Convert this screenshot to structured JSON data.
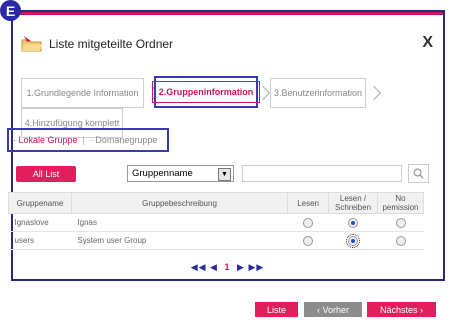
{
  "marker": "E",
  "dialog": {
    "title": "Liste mitgeteilte Ordner",
    "close_label": "X"
  },
  "steps": [
    {
      "label": "1.Grundlegende Information",
      "active": false
    },
    {
      "label": "2.Gruppeninformation",
      "active": true
    },
    {
      "label": "3.Benutzerinformation",
      "active": false
    },
    {
      "label": "4.Hinzufügung komplett",
      "active": false
    }
  ],
  "group_type": {
    "local": "Lokale Gruppe",
    "separator": "|",
    "domain": "Domanegruppe"
  },
  "toolbar": {
    "all_list_label": "All List",
    "filter_value": "Gruppenname",
    "search_value": ""
  },
  "table": {
    "headers": {
      "name": "Gruppename",
      "desc": "Gruppebeschreibung",
      "read": "Lesen",
      "rw_line1": "Lesen /",
      "rw_line2": "Schreiben",
      "np_line1": "No",
      "np_line2": "pemission"
    },
    "rows": [
      {
        "name": "Ignaslove",
        "desc": "Ignas",
        "selected": "rw"
      },
      {
        "name": "users",
        "desc": "System user Group",
        "selected": "rw"
      }
    ]
  },
  "pager": {
    "first": "◀◀",
    "prev": "◀",
    "current": "1",
    "next": "▶",
    "last": "▶▶"
  },
  "footer": {
    "list_label": "Liste",
    "prev_label": "‹ Vorher",
    "next_label": "Nächstes ›"
  },
  "colors": {
    "accent": "#e01f5c",
    "highlight_border": "#3a3ab0",
    "prev_button": "#8c8c8c"
  }
}
